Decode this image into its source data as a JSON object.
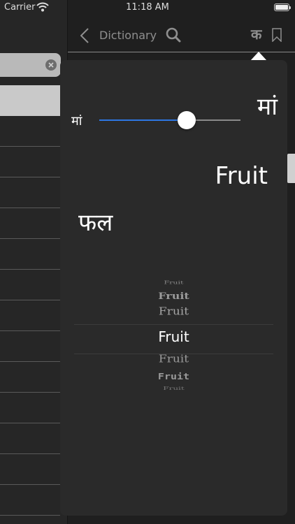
{
  "status": {
    "carrier": "Carrier",
    "time": "11:18 AM"
  },
  "nav": {
    "back_icon": "chevron-left-icon",
    "title": "Dictionary",
    "search_icon": "search-icon",
    "language_icon_glyph": "क",
    "bookmark_icon": "bookmark-icon"
  },
  "popover": {
    "small_sample": "मां",
    "large_sample": "मां",
    "font_size_level": 0.62,
    "english_word": "Fruit",
    "hindi_word": "फल",
    "font_picker": [
      "Fruit",
      "Fruit",
      "Fruit",
      "Fruit",
      "Fruit",
      "Fruit",
      "Fruit"
    ],
    "selected_index": 3
  },
  "colors": {
    "slider_fill": "#2d77e3",
    "background": "#1f1f1f",
    "popover": "#2a2a2a"
  }
}
